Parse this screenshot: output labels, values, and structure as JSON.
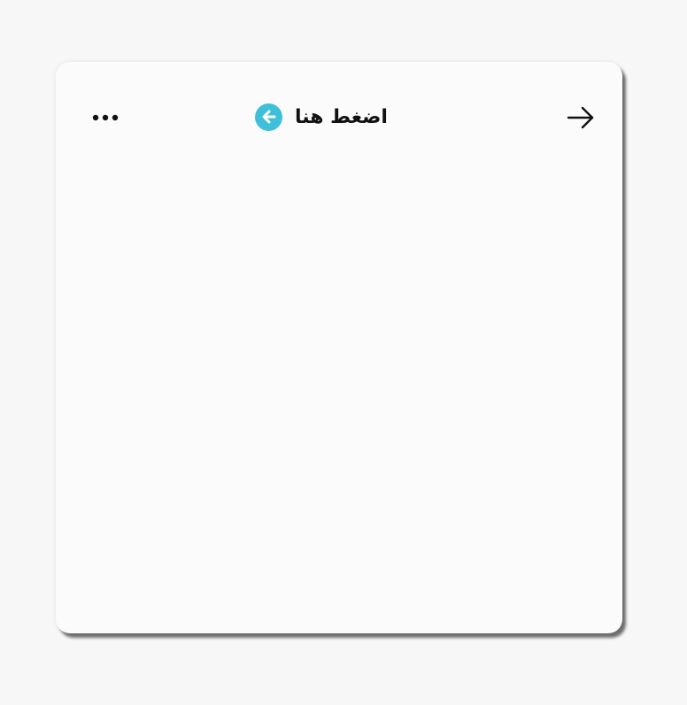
{
  "window": {
    "background": "#fcfbfc"
  },
  "header": {
    "title": "اضغط هنا",
    "accent_color": "#3fc0da",
    "more_icon": "more-horizontal-icon",
    "back_icon": "arrow-left-circle-icon",
    "forward_icon": "arrow-right-icon"
  }
}
